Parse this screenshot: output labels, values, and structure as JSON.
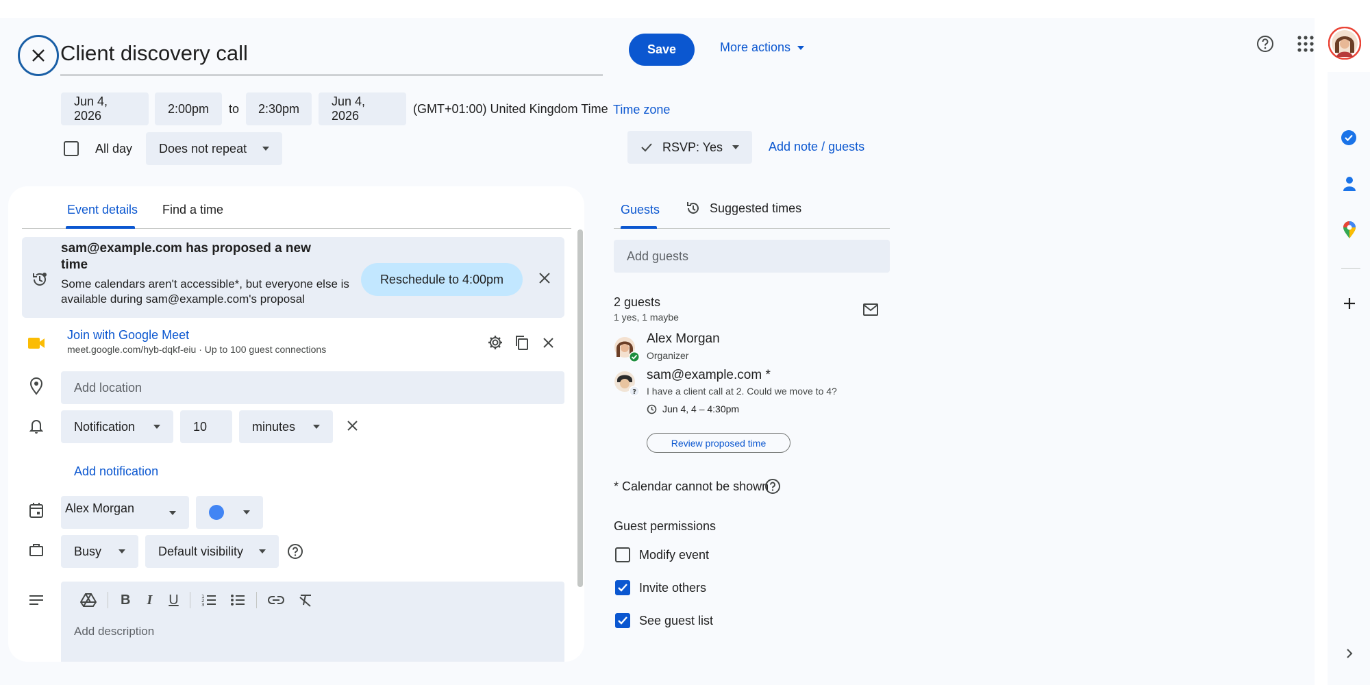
{
  "event": {
    "title": "Client discovery call",
    "start_date": "Jun 4, 2026",
    "start_time": "2:00pm",
    "to": "to",
    "end_time": "2:30pm",
    "end_date": "Jun 4, 2026",
    "timezone_label": "(GMT+01:00) United Kingdom Time",
    "timezone_link": "Time zone",
    "all_day": "All day",
    "repeat": "Does not repeat"
  },
  "toolbar": {
    "save": "Save",
    "more_actions": "More actions"
  },
  "rsvp": {
    "label": "RSVP: Yes",
    "add_note": "Add note / guests"
  },
  "tabs": {
    "event_details": "Event details",
    "find_time": "Find a time",
    "guests": "Guests",
    "suggested_times": "Suggested times"
  },
  "proposal": {
    "title": "sam@example.com has proposed a new time",
    "body": "Some calendars aren't accessible*, but everyone else is available during sam@example.com's proposal",
    "reschedule": "Reschedule to 4:00pm"
  },
  "meet": {
    "link": "Join with Google Meet",
    "details": "meet.google.com/hyb-dqkf-eiu · Up to 100 guest connections"
  },
  "location": {
    "placeholder": "Add location"
  },
  "notification": {
    "type": "Notification",
    "amount": "10",
    "unit": "minutes",
    "add": "Add notification"
  },
  "calendar": {
    "owner": "Alex Morgan",
    "color": "#4285f4"
  },
  "status": {
    "availability": "Busy",
    "visibility": "Default visibility"
  },
  "description": {
    "placeholder": "Add description"
  },
  "guests": {
    "placeholder": "Add guests",
    "count": "2 guests",
    "summary": "1 yes, 1 maybe",
    "list": [
      {
        "name": "Alex Morgan",
        "role": "Organizer"
      },
      {
        "name": "sam@example.com *",
        "note": "I have a client call at 2. Could we move to 4?",
        "proposal": "Jun 4, 4 – 4:30pm",
        "action": "Review proposed time"
      }
    ],
    "calendar_note": "* Calendar cannot be shown"
  },
  "permissions": {
    "heading": "Guest permissions",
    "items": [
      {
        "label": "Modify event",
        "checked": false
      },
      {
        "label": "Invite others",
        "checked": true
      },
      {
        "label": "See guest list",
        "checked": true
      }
    ]
  },
  "colors": {
    "accent": "#0b57d0",
    "surface": "#e9eef6",
    "reschedule": "#c2e7ff"
  }
}
